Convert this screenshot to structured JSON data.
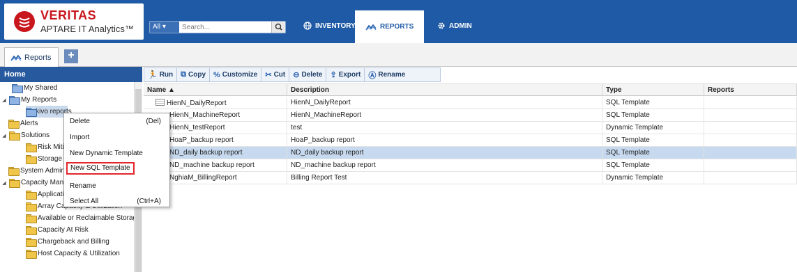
{
  "header": {
    "brand": "VERITAS",
    "product": "APTARE IT Analytics™",
    "search_scope": "All ▾",
    "search_placeholder": "Search...",
    "nav": [
      {
        "label": "INVENTORY",
        "icon": "globe-icon"
      },
      {
        "label": "REPORTS",
        "icon": "chart-icon"
      },
      {
        "label": "ADMIN",
        "icon": "gear-icon"
      }
    ]
  },
  "subtabs": {
    "reports_label": "Reports",
    "add_label": "+"
  },
  "left_panel": {
    "home_label": "Home",
    "tree": [
      {
        "label": "My Shared"
      },
      {
        "label": "My Reports"
      },
      {
        "label": "nakivo reports"
      },
      {
        "label": "Alerts"
      },
      {
        "label": "Solutions"
      },
      {
        "label": "Risk Mitigation"
      },
      {
        "label": "Storage Optimization"
      },
      {
        "label": "System Administration"
      },
      {
        "label": "Capacity Management"
      },
      {
        "label": "Application Capacity"
      },
      {
        "label": "Array Capacity & Utilization"
      },
      {
        "label": "Available or Reclaimable Storage"
      },
      {
        "label": "Capacity At Risk"
      },
      {
        "label": "Chargeback and Billing"
      },
      {
        "label": "Host Capacity & Utilization"
      }
    ]
  },
  "context_menu": {
    "items": [
      {
        "label": "Delete",
        "shortcut": "(Del)"
      },
      {
        "label": "Import",
        "shortcut": ""
      },
      {
        "label": "New Dynamic Template",
        "shortcut": ""
      },
      {
        "label": "New SQL Template",
        "shortcut": ""
      },
      {
        "label": "Rename",
        "shortcut": ""
      },
      {
        "label": "Select All",
        "shortcut": "(Ctrl+A)"
      }
    ],
    "highlighted": "New SQL Template"
  },
  "toolbar": {
    "buttons": [
      "Run",
      "Copy",
      "Customize",
      "Cut",
      "Delete",
      "Export",
      "Rename"
    ]
  },
  "grid": {
    "columns": [
      "Name ▲",
      "Description",
      "Type",
      "Reports"
    ],
    "rows": [
      {
        "name": "HienN_DailyReport",
        "description": "HienN_DailyReport",
        "type": "SQL Template",
        "reports": ""
      },
      {
        "name": "HienN_MachineReport",
        "description": "HienN_MachineReport",
        "type": "SQL Template",
        "reports": ""
      },
      {
        "name": "HienN_testReport",
        "description": "test",
        "type": "Dynamic Template",
        "reports": ""
      },
      {
        "name": "HoaP_backup report",
        "description": "HoaP_backup report",
        "type": "SQL Template",
        "reports": ""
      },
      {
        "name": "ND_daily backup report",
        "description": "ND_daily backup report",
        "type": "SQL Template",
        "reports": ""
      },
      {
        "name": "ND_machine backup report",
        "description": "ND_machine backup report",
        "type": "SQL Template",
        "reports": ""
      },
      {
        "name": "NghiaM_BillingReport",
        "description": "Billing Report Test",
        "type": "Dynamic Template",
        "reports": ""
      }
    ],
    "selected_row": 4
  },
  "colors": {
    "header_bg": "#1f5aa6",
    "brand_red": "#c8161d",
    "selected_row": "#c6d9ee",
    "menu_highlight_border": "#e2262b"
  }
}
